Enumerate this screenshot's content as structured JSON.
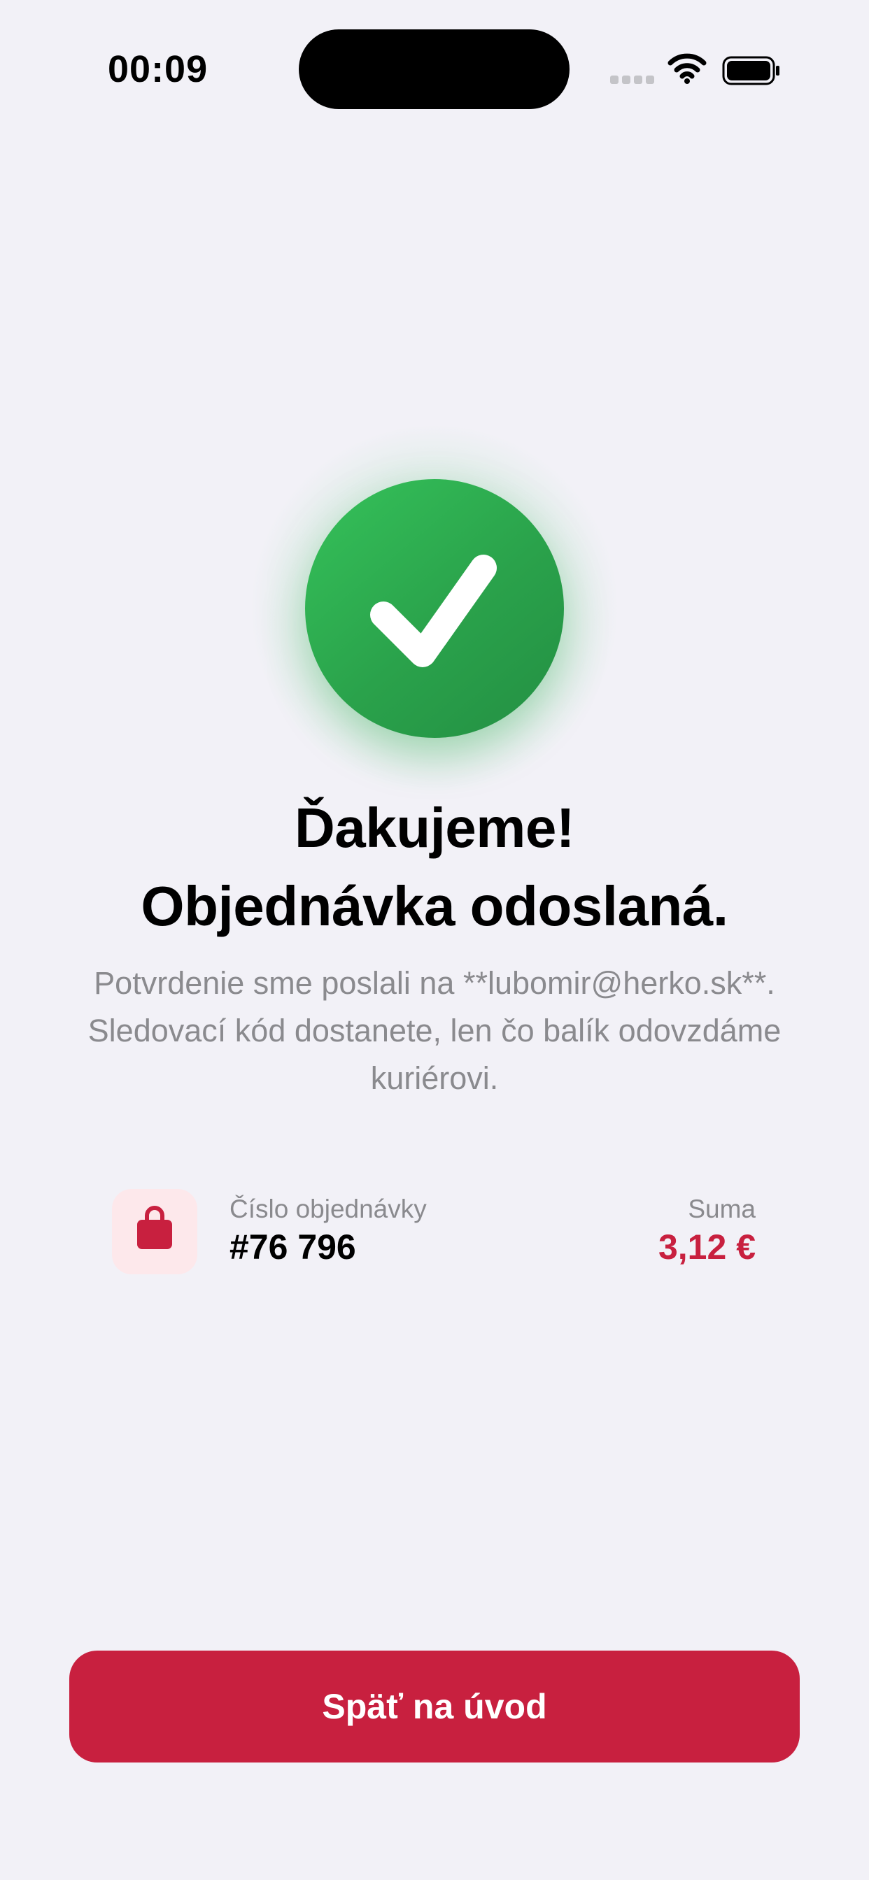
{
  "status_bar": {
    "time": "00:09",
    "icons": [
      "signal-icon",
      "wifi-icon",
      "battery-icon"
    ]
  },
  "success": {
    "icon": "checkmark-icon",
    "title_line1": "Ďakujeme!",
    "title_line2": "Objednávka odoslaná.",
    "message": "Potvrdenie sme poslali na **lubomir@herko.sk**. Sledovací kód dostanete, len čo balík odovzdáme kuriérovi."
  },
  "order": {
    "icon": "shopping-bag-icon",
    "number_label": "Číslo objednávky",
    "number": "#76 796",
    "sum_label": "Suma",
    "sum": "3,12 €"
  },
  "actions": {
    "home_button_label": "Späť na úvod"
  },
  "colors": {
    "background": "#f2f1f7",
    "success_green": "#2aa24b",
    "accent_red": "#c8203f",
    "icon_bg_pink": "#fde8eb",
    "secondary_text": "#8a8a8e"
  }
}
